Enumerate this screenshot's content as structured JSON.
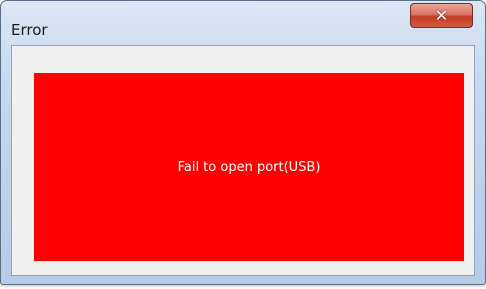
{
  "window": {
    "title": "Error",
    "close_icon": "✕",
    "icon_names": {
      "close": "close-icon"
    }
  },
  "panel": {
    "message": "Fail to open port(USB)",
    "background_color": "#ff0000",
    "text_color": "#ffffff"
  }
}
